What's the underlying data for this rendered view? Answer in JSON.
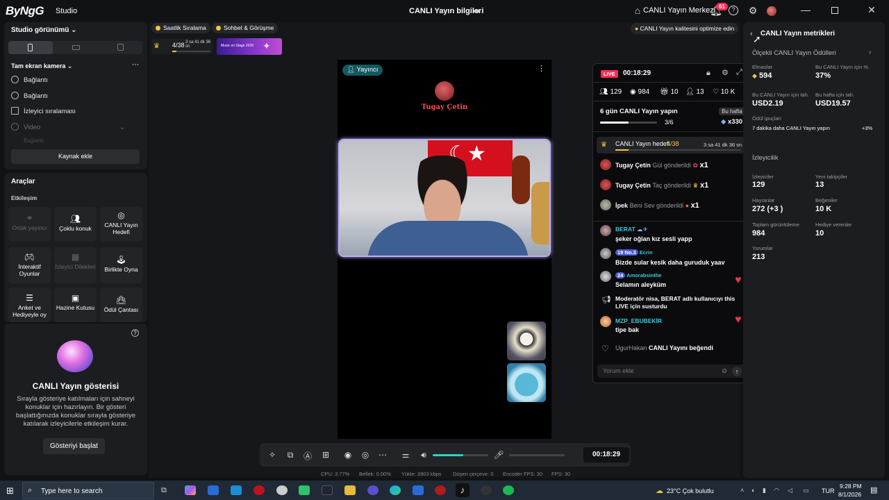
{
  "titlebar": {
    "logo": "ByNgG",
    "studio": "Studio",
    "title": "CANLI Yayın bilgileri",
    "center_link": "CANLI Yayın Merkezi",
    "notif_count": "61"
  },
  "left": {
    "view_label": "Studio görünümü",
    "camera_label": "Tam ekran kamera",
    "sources": [
      "Bağlantı",
      "Bağlantı",
      "İzleyici sıralaması",
      "Video",
      "Bağlantı"
    ],
    "add_source": "Kaynak ekle",
    "tools_title": "Araçlar",
    "engagement": "Etkileşim",
    "tools": [
      {
        "label": "Ortak yayıncı",
        "disabled": true
      },
      {
        "label": "Çoklu konuk",
        "disabled": false
      },
      {
        "label": "CANLI Yayın Hedefi",
        "disabled": false
      },
      {
        "label": "İnteraktif Oyunlar",
        "disabled": false
      },
      {
        "label": "İzleyici Dilekleri",
        "disabled": true
      },
      {
        "label": "Birlikte Oyna",
        "disabled": false
      },
      {
        "label": "Anket ve Hediyeyle oy",
        "disabled": false
      },
      {
        "label": "Hazine Kutusu",
        "disabled": false
      },
      {
        "label": "Ödül Çantası",
        "disabled": false
      }
    ],
    "show_title": "CANLI Yayın gösterisi",
    "show_desc": "Sırayla gösteriye katılmaları için sahneyi konuklar için hazırlayın. Bir gösteri başlattığınızda konuklar sırayla gösteriye katılarak izleyicilerle etkileşim kurar.",
    "show_button": "Gösteriyi başlat"
  },
  "main": {
    "chip1": "Saatlik Sıralama",
    "chip2": "Sohbet & Görüşme",
    "mini_goal": "4/38",
    "mini_time": "3 sa 41 dk 36 sn",
    "gift_card": "Music on Stage 2026",
    "optimize": "CANLI Yayın kalitesini optimize edin",
    "broadcaster_badge": "Yayıncı",
    "broadcaster_name": "Tugay Çetin"
  },
  "chat": {
    "live": "LIVE",
    "timer": "00:18:29",
    "stats": [
      "129",
      "984",
      "10",
      "13",
      "10 K"
    ],
    "goal_title": "6 gün CANLI Yayın yapın",
    "goal_badge": "Bu hafta",
    "goal_progress": "3/6",
    "goal_progress_value": 0.5,
    "goal_reward": "x330",
    "live_goal": "CANLI Yayın hedefi",
    "live_goal_count": "4/38",
    "live_goal_time": "3 sa 41 dk 36 sn",
    "live_goal_value": 0.1053,
    "gifts": [
      {
        "user": "Tugay Çetin",
        "action": "Gül gönderildi",
        "count": "x1"
      },
      {
        "user": "Tugay Çetin",
        "action": "Taç gönderildi",
        "count": "x1"
      },
      {
        "user": "İpek",
        "action": "Beni Sev gönderildi",
        "count": "x1"
      }
    ],
    "messages": [
      {
        "user": "BERAT",
        "text": "şeker oğlan kız sesli yapp",
        "badges": ""
      },
      {
        "user": "Ecrin",
        "text": "Bizde sular kesik daha guruduk yaav",
        "badges": "19 No.3"
      },
      {
        "user": "Amorabsinthe",
        "text": "Selamın aleyküm",
        "badges": "24"
      },
      {
        "user": "Moderatör",
        "text": "nisa, BERAT adlı kullanıcıyı this LIVE için susturdu",
        "badges": ""
      },
      {
        "user": "MZP_EBUBEKİR",
        "text": "tipe bak",
        "badges": ""
      },
      {
        "user": "UgurHakan",
        "text": "CANLI Yayını beğendi",
        "badges": ""
      }
    ],
    "comment_placeholder": "Yorum ekle"
  },
  "metrics": {
    "back_title": "CANLI Yayın metrikleri",
    "rewards_title": "Ölçekli CANLI Yayın Ödülleri",
    "diamonds_label": "Elmaslar",
    "diamonds": "594",
    "percent_label": "Bu CANLI Yayın için %",
    "percent": "37%",
    "earned_label": "Bu CANLI Yayın için tah.",
    "earned": "USD2.19",
    "week_label": "Bu hafta için tah.",
    "week": "USD19.57",
    "tips_label": "Ödül ipuçları",
    "tip_text": "7 dakika daha CANLI Yayın yapın",
    "tip_value": "+3%",
    "viewers_title": "İzleyicilik",
    "viewers_label": "İzleyiciler",
    "viewers": "129",
    "followers_label": "Yeni takipçiler",
    "followers": "13",
    "fans_label": "Hayranlar",
    "fans": "272 (+3 )",
    "likes_label": "Beğeniler",
    "likes": "10 K",
    "views_label": "Toplam görüntüleme",
    "views": "984",
    "gifters_label": "Hediye verenler",
    "gifters": "10",
    "comments_label": "Yorumlar",
    "comments": "213"
  },
  "bottom": {
    "timer": "00:18:29",
    "volume_value": 0.55,
    "cpu": "CPU: 3.77%",
    "mem": "Bellek: 0.00%",
    "upload": "Yükle: 3903 kbps",
    "dropped": "Düşen çerçeve: 0",
    "enc": "Encoder FPS: 30",
    "fps": "FPS: 30"
  },
  "taskbar": {
    "search_placeholder": "Type here to search",
    "weather": "23°C Çok bulutlu",
    "lang": "TUR",
    "time": "9:28 PM",
    "date": "8/1/2026"
  }
}
